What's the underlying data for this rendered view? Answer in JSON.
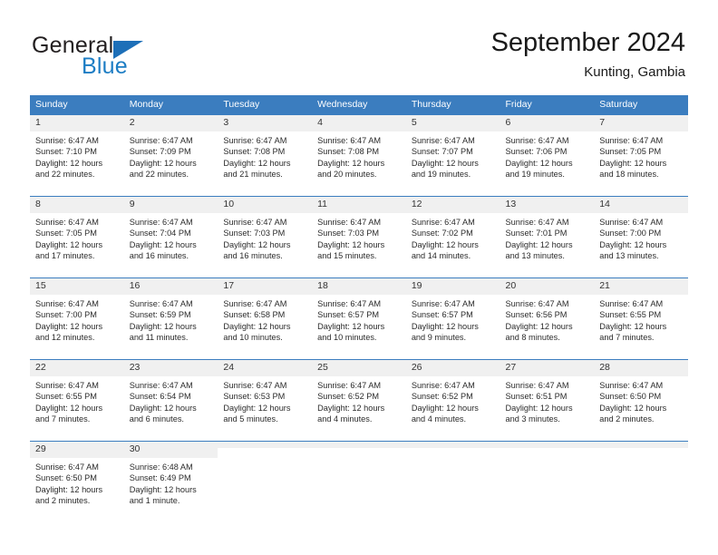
{
  "logo": {
    "word_top": "General",
    "word_bottom": "Blue",
    "triangle_icon": "triangle-icon",
    "color_dark": "#231f20",
    "color_blue": "#1d7dc4"
  },
  "header": {
    "title": "September 2024",
    "subtitle": "Kunting, Gambia"
  },
  "theme": {
    "header_blue": "#3b7dbf",
    "daynum_bg": "#f0f0f0"
  },
  "weekdays": [
    "Sunday",
    "Monday",
    "Tuesday",
    "Wednesday",
    "Thursday",
    "Friday",
    "Saturday"
  ],
  "weeks": [
    [
      {
        "day": "1",
        "sunrise": "Sunrise: 6:47 AM",
        "sunset": "Sunset: 7:10 PM",
        "daylight_line1": "Daylight: 12 hours",
        "daylight_line2": "and 22 minutes."
      },
      {
        "day": "2",
        "sunrise": "Sunrise: 6:47 AM",
        "sunset": "Sunset: 7:09 PM",
        "daylight_line1": "Daylight: 12 hours",
        "daylight_line2": "and 22 minutes."
      },
      {
        "day": "3",
        "sunrise": "Sunrise: 6:47 AM",
        "sunset": "Sunset: 7:08 PM",
        "daylight_line1": "Daylight: 12 hours",
        "daylight_line2": "and 21 minutes."
      },
      {
        "day": "4",
        "sunrise": "Sunrise: 6:47 AM",
        "sunset": "Sunset: 7:08 PM",
        "daylight_line1": "Daylight: 12 hours",
        "daylight_line2": "and 20 minutes."
      },
      {
        "day": "5",
        "sunrise": "Sunrise: 6:47 AM",
        "sunset": "Sunset: 7:07 PM",
        "daylight_line1": "Daylight: 12 hours",
        "daylight_line2": "and 19 minutes."
      },
      {
        "day": "6",
        "sunrise": "Sunrise: 6:47 AM",
        "sunset": "Sunset: 7:06 PM",
        "daylight_line1": "Daylight: 12 hours",
        "daylight_line2": "and 19 minutes."
      },
      {
        "day": "7",
        "sunrise": "Sunrise: 6:47 AM",
        "sunset": "Sunset: 7:05 PM",
        "daylight_line1": "Daylight: 12 hours",
        "daylight_line2": "and 18 minutes."
      }
    ],
    [
      {
        "day": "8",
        "sunrise": "Sunrise: 6:47 AM",
        "sunset": "Sunset: 7:05 PM",
        "daylight_line1": "Daylight: 12 hours",
        "daylight_line2": "and 17 minutes."
      },
      {
        "day": "9",
        "sunrise": "Sunrise: 6:47 AM",
        "sunset": "Sunset: 7:04 PM",
        "daylight_line1": "Daylight: 12 hours",
        "daylight_line2": "and 16 minutes."
      },
      {
        "day": "10",
        "sunrise": "Sunrise: 6:47 AM",
        "sunset": "Sunset: 7:03 PM",
        "daylight_line1": "Daylight: 12 hours",
        "daylight_line2": "and 16 minutes."
      },
      {
        "day": "11",
        "sunrise": "Sunrise: 6:47 AM",
        "sunset": "Sunset: 7:03 PM",
        "daylight_line1": "Daylight: 12 hours",
        "daylight_line2": "and 15 minutes."
      },
      {
        "day": "12",
        "sunrise": "Sunrise: 6:47 AM",
        "sunset": "Sunset: 7:02 PM",
        "daylight_line1": "Daylight: 12 hours",
        "daylight_line2": "and 14 minutes."
      },
      {
        "day": "13",
        "sunrise": "Sunrise: 6:47 AM",
        "sunset": "Sunset: 7:01 PM",
        "daylight_line1": "Daylight: 12 hours",
        "daylight_line2": "and 13 minutes."
      },
      {
        "day": "14",
        "sunrise": "Sunrise: 6:47 AM",
        "sunset": "Sunset: 7:00 PM",
        "daylight_line1": "Daylight: 12 hours",
        "daylight_line2": "and 13 minutes."
      }
    ],
    [
      {
        "day": "15",
        "sunrise": "Sunrise: 6:47 AM",
        "sunset": "Sunset: 7:00 PM",
        "daylight_line1": "Daylight: 12 hours",
        "daylight_line2": "and 12 minutes."
      },
      {
        "day": "16",
        "sunrise": "Sunrise: 6:47 AM",
        "sunset": "Sunset: 6:59 PM",
        "daylight_line1": "Daylight: 12 hours",
        "daylight_line2": "and 11 minutes."
      },
      {
        "day": "17",
        "sunrise": "Sunrise: 6:47 AM",
        "sunset": "Sunset: 6:58 PM",
        "daylight_line1": "Daylight: 12 hours",
        "daylight_line2": "and 10 minutes."
      },
      {
        "day": "18",
        "sunrise": "Sunrise: 6:47 AM",
        "sunset": "Sunset: 6:57 PM",
        "daylight_line1": "Daylight: 12 hours",
        "daylight_line2": "and 10 minutes."
      },
      {
        "day": "19",
        "sunrise": "Sunrise: 6:47 AM",
        "sunset": "Sunset: 6:57 PM",
        "daylight_line1": "Daylight: 12 hours",
        "daylight_line2": "and 9 minutes."
      },
      {
        "day": "20",
        "sunrise": "Sunrise: 6:47 AM",
        "sunset": "Sunset: 6:56 PM",
        "daylight_line1": "Daylight: 12 hours",
        "daylight_line2": "and 8 minutes."
      },
      {
        "day": "21",
        "sunrise": "Sunrise: 6:47 AM",
        "sunset": "Sunset: 6:55 PM",
        "daylight_line1": "Daylight: 12 hours",
        "daylight_line2": "and 7 minutes."
      }
    ],
    [
      {
        "day": "22",
        "sunrise": "Sunrise: 6:47 AM",
        "sunset": "Sunset: 6:55 PM",
        "daylight_line1": "Daylight: 12 hours",
        "daylight_line2": "and 7 minutes."
      },
      {
        "day": "23",
        "sunrise": "Sunrise: 6:47 AM",
        "sunset": "Sunset: 6:54 PM",
        "daylight_line1": "Daylight: 12 hours",
        "daylight_line2": "and 6 minutes."
      },
      {
        "day": "24",
        "sunrise": "Sunrise: 6:47 AM",
        "sunset": "Sunset: 6:53 PM",
        "daylight_line1": "Daylight: 12 hours",
        "daylight_line2": "and 5 minutes."
      },
      {
        "day": "25",
        "sunrise": "Sunrise: 6:47 AM",
        "sunset": "Sunset: 6:52 PM",
        "daylight_line1": "Daylight: 12 hours",
        "daylight_line2": "and 4 minutes."
      },
      {
        "day": "26",
        "sunrise": "Sunrise: 6:47 AM",
        "sunset": "Sunset: 6:52 PM",
        "daylight_line1": "Daylight: 12 hours",
        "daylight_line2": "and 4 minutes."
      },
      {
        "day": "27",
        "sunrise": "Sunrise: 6:47 AM",
        "sunset": "Sunset: 6:51 PM",
        "daylight_line1": "Daylight: 12 hours",
        "daylight_line2": "and 3 minutes."
      },
      {
        "day": "28",
        "sunrise": "Sunrise: 6:47 AM",
        "sunset": "Sunset: 6:50 PM",
        "daylight_line1": "Daylight: 12 hours",
        "daylight_line2": "and 2 minutes."
      }
    ],
    [
      {
        "day": "29",
        "sunrise": "Sunrise: 6:47 AM",
        "sunset": "Sunset: 6:50 PM",
        "daylight_line1": "Daylight: 12 hours",
        "daylight_line2": "and 2 minutes."
      },
      {
        "day": "30",
        "sunrise": "Sunrise: 6:48 AM",
        "sunset": "Sunset: 6:49 PM",
        "daylight_line1": "Daylight: 12 hours",
        "daylight_line2": "and 1 minute."
      },
      {
        "day": "",
        "sunrise": "",
        "sunset": "",
        "daylight_line1": "",
        "daylight_line2": ""
      },
      {
        "day": "",
        "sunrise": "",
        "sunset": "",
        "daylight_line1": "",
        "daylight_line2": ""
      },
      {
        "day": "",
        "sunrise": "",
        "sunset": "",
        "daylight_line1": "",
        "daylight_line2": ""
      },
      {
        "day": "",
        "sunrise": "",
        "sunset": "",
        "daylight_line1": "",
        "daylight_line2": ""
      },
      {
        "day": "",
        "sunrise": "",
        "sunset": "",
        "daylight_line1": "",
        "daylight_line2": ""
      }
    ]
  ]
}
